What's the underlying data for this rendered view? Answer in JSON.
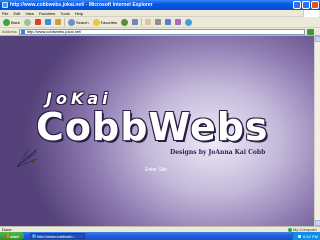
{
  "window": {
    "title": "http://www.cobbwebs.jokai.net/ - Microsoft Internet Explorer"
  },
  "menu": [
    "File",
    "Edit",
    "View",
    "Favorites",
    "Tools",
    "Help"
  ],
  "toolbar": {
    "back": "Back",
    "search": "Search",
    "favorites": "Favorites"
  },
  "address": {
    "label": "Address",
    "url": "http://www.cobbwebs.jokai.net/"
  },
  "page": {
    "brand_top": "JoKai",
    "brand_main": "CobbWebs",
    "tagline": "Designs by JoAnna Kai Cobb",
    "enter_link": "Enter Site"
  },
  "statusbar": {
    "status": "Done",
    "zone": "My Computer"
  },
  "taskbar": {
    "start": "start",
    "task": "http://www.cobbweb...",
    "clock": "6:42 PM"
  }
}
